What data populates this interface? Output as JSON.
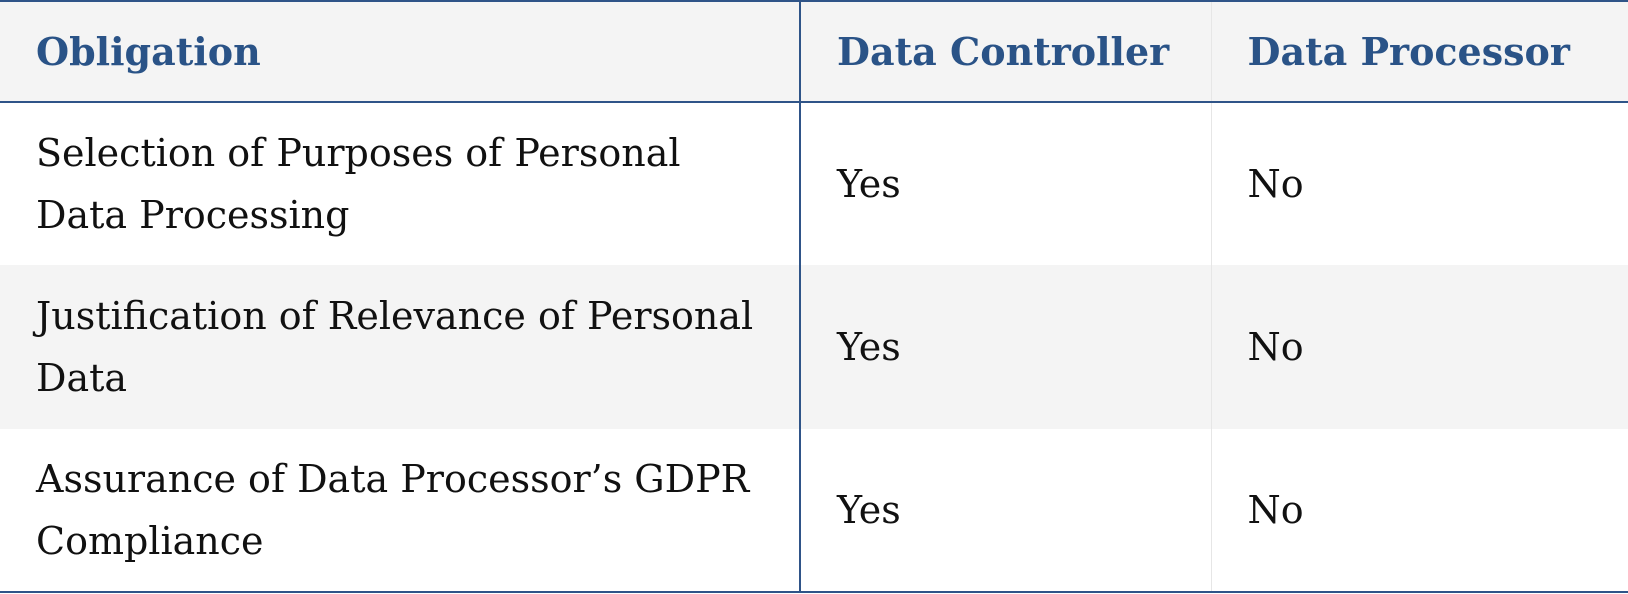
{
  "table": {
    "headers": {
      "obligation": "Obligation",
      "controller": "Data Controller",
      "processor": "Data Processor"
    },
    "rows": [
      {
        "obligation": "Selection of Purposes of Personal Data Processing",
        "controller": "Yes",
        "processor": "No"
      },
      {
        "obligation": "Justification of Relevance of Personal Data",
        "controller": "Yes",
        "processor": "No"
      },
      {
        "obligation": "Assurance of Data Processor’s GDPR Compliance",
        "controller": "Yes",
        "processor": "No"
      }
    ]
  },
  "colors": {
    "accent": "#2a5387",
    "border": "#2f5488",
    "stripe": "#f4f4f4"
  }
}
